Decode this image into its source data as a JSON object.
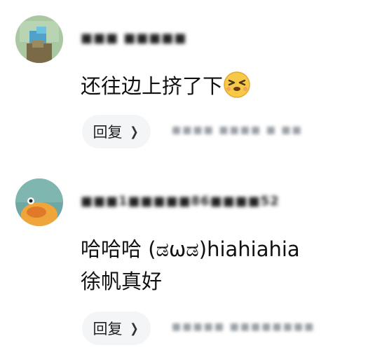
{
  "comments": [
    {
      "username": "■■■ ■■■■■",
      "text": "还往边上挤了下",
      "emoji": "laugh-squint-emoji",
      "reply_label": "回复",
      "meta": "■■■■ ■■■■ ■ ■■"
    },
    {
      "username": "■■■1■■■■■86■■■■52",
      "text_line1": "哈哈哈 (ಡωಡ)hiahiahia",
      "text_line2": "徐帆真好",
      "reply_label": "回复",
      "meta": "■■■■■ ■■■■■■■■"
    }
  ],
  "colors": {
    "reply_bg": "#f4f5f7",
    "meta_text": "#9aa0a6",
    "emoji_yellow": "#f7c948"
  }
}
